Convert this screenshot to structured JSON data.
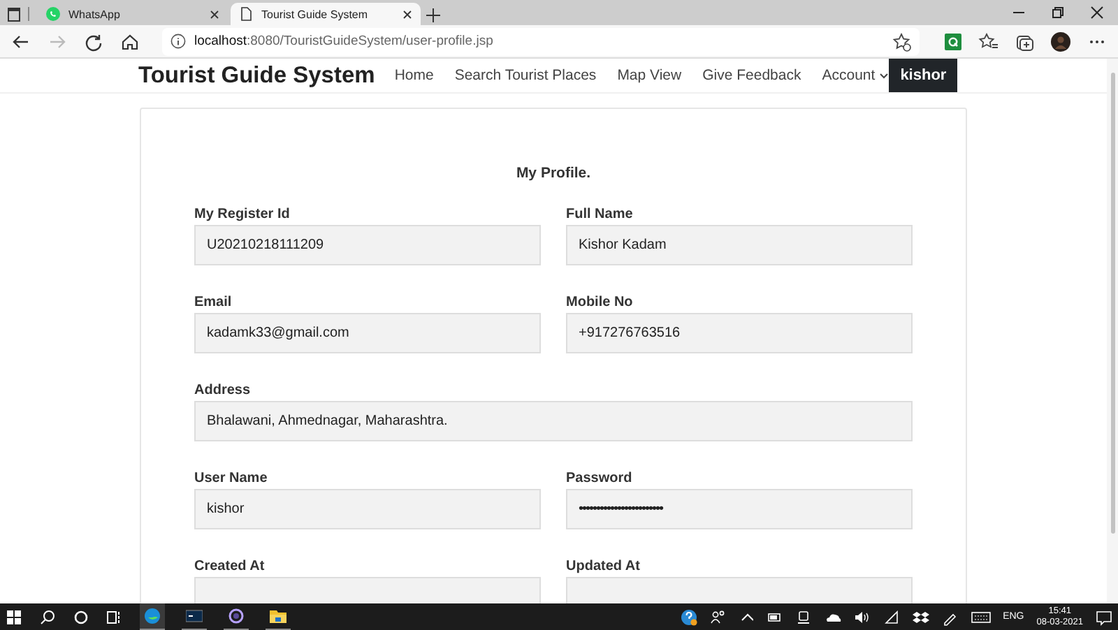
{
  "browser": {
    "tabs": [
      {
        "title": "WhatsApp",
        "selected": false
      },
      {
        "title": "Tourist Guide System",
        "selected": true
      }
    ],
    "address": {
      "host": "localhost",
      "path": ":8080/TouristGuideSystem/user-profile.jsp"
    }
  },
  "site": {
    "brand": "Tourist Guide System",
    "nav": [
      {
        "label": "Home",
        "kind": "link"
      },
      {
        "label": "Search Tourist Places",
        "kind": "link"
      },
      {
        "label": "Map View",
        "kind": "link"
      },
      {
        "label": "Give Feedback",
        "kind": "link"
      },
      {
        "label": "Account",
        "kind": "dropdown"
      }
    ],
    "user_button": "kishor"
  },
  "profile": {
    "title": "My Profile.",
    "rows": [
      [
        {
          "label": "My Register Id",
          "value": "U20210218111209",
          "kind": "text"
        },
        {
          "label": "Full Name",
          "value": "Kishor Kadam",
          "kind": "text"
        }
      ],
      [
        {
          "label": "Email",
          "value": "kadamk33@gmail.com",
          "kind": "text"
        },
        {
          "label": "Mobile No",
          "value": "+917276763516",
          "kind": "text"
        }
      ],
      [
        {
          "label": "Address",
          "value": "Bhalawani, Ahmednagar, Maharashtra.",
          "kind": "text"
        }
      ],
      [
        {
          "label": "User Name",
          "value": "kishor",
          "kind": "text"
        },
        {
          "label": "Password",
          "value": "••••••••••••••••••••••••",
          "kind": "password"
        }
      ],
      [
        {
          "label": "Created At",
          "kind": "text"
        },
        {
          "label": "Updated At",
          "kind": "text"
        }
      ]
    ]
  },
  "taskbar": {
    "language": "ENG",
    "time": "15:41",
    "date": "08-03-2021"
  }
}
